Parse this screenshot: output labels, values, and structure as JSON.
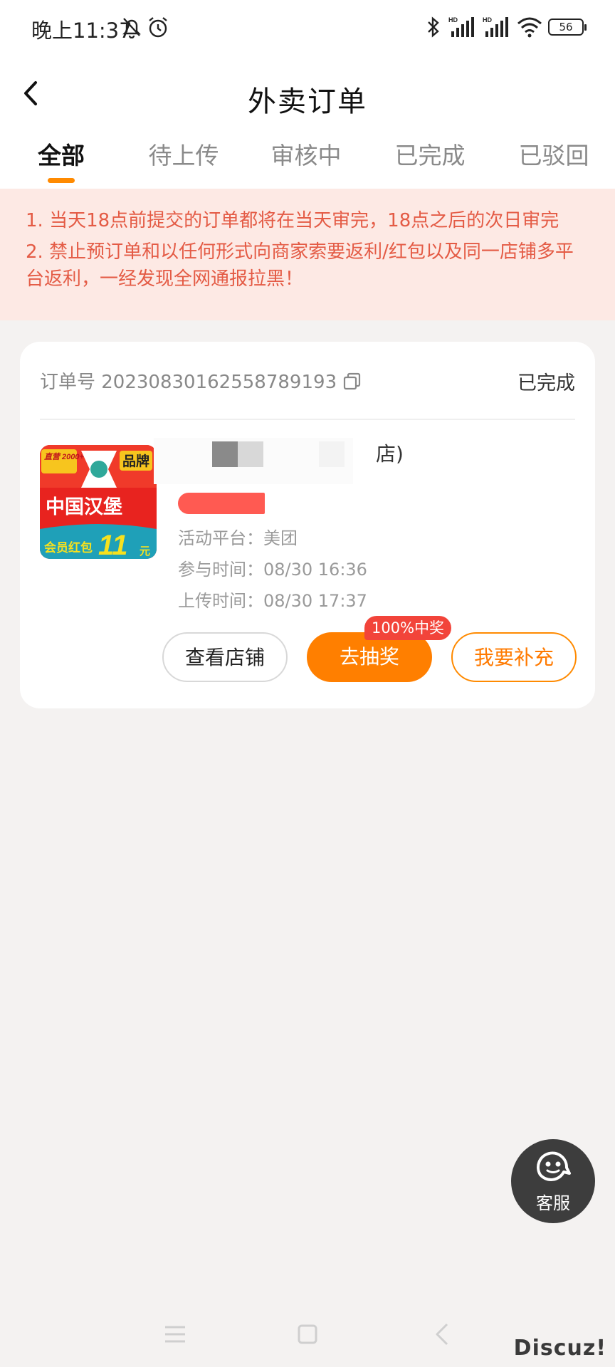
{
  "status_bar": {
    "time": "晚上11:37",
    "battery": "56",
    "icons": [
      "bell-off-icon",
      "alarm-icon",
      "bluetooth-icon",
      "hd-signal-icon",
      "hd-signal-icon",
      "wifi-icon",
      "battery-icon"
    ]
  },
  "nav": {
    "title": "外卖订单",
    "back_icon": "chevron-left-icon"
  },
  "tabs": [
    {
      "label": "全部",
      "active": true
    },
    {
      "label": "待上传",
      "active": false
    },
    {
      "label": "审核中",
      "active": false
    },
    {
      "label": "已完成",
      "active": false
    },
    {
      "label": "已驳回",
      "active": false
    }
  ],
  "notice": {
    "line1": "1. 当天18点前提交的订单都将在当天审完，18点之后的次日审完",
    "line2": "2. 禁止预订单和以任何形式向商家索要返利/红包以及同一店铺多平台返利，一经发现全网通报拉黑！"
  },
  "order": {
    "order_no_label": "订单号 20230830162558789193",
    "status": "已完成",
    "title_suffix": "店)",
    "product_image": {
      "brand_tag": "品牌",
      "top_tag": "直营 2000+",
      "name": "中国汉堡",
      "bottom_text": "会员红包",
      "amount": "11",
      "unit": "元"
    },
    "platform_label": "活动平台：美团",
    "join_time_label": "参与时间：08/30 16:36",
    "upload_time_label": "上传时间：08/30 17:37",
    "buttons": {
      "view_store": "查看店铺",
      "lottery": "去抽奖",
      "supplement": "我要补充"
    },
    "prize_badge": "100%中奖"
  },
  "service": {
    "label": "客服"
  },
  "watermark": "Discuz!",
  "colors": {
    "accent": "#ff7f00",
    "notice_bg": "#fde9e4",
    "notice_text": "#e45b45",
    "badge": "#f2443a",
    "page_bg": "#f4f2f1"
  }
}
